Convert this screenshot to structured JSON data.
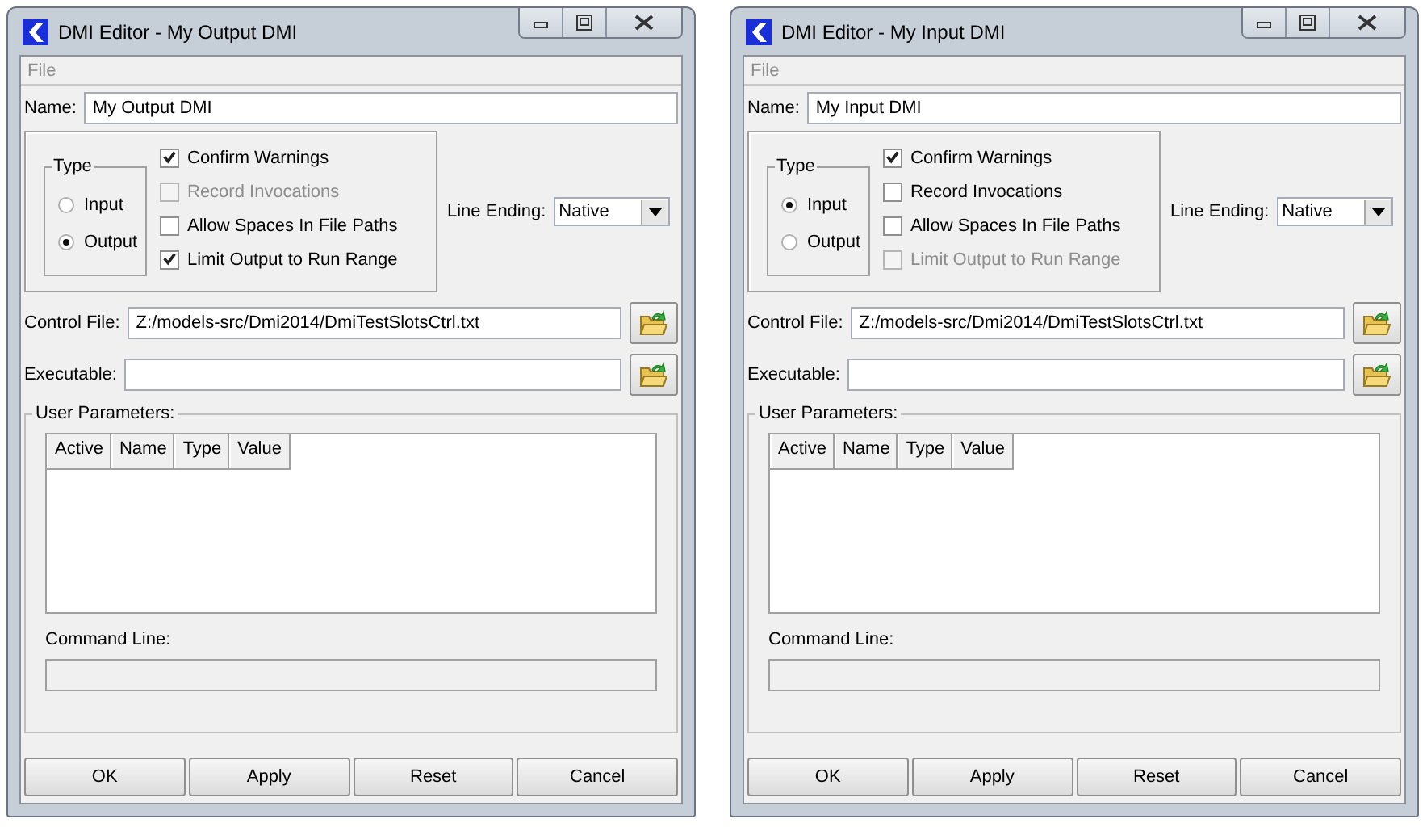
{
  "windows": [
    {
      "title": "DMI Editor - My Output DMI",
      "menu": [
        {
          "label": "File",
          "disabled": true
        }
      ],
      "name_label": "Name:",
      "name_value": "My Output DMI",
      "type_group": {
        "legend": "Type",
        "options": [
          {
            "label": "Input",
            "selected": false
          },
          {
            "label": "Output",
            "selected": true
          }
        ]
      },
      "checkboxes": [
        {
          "label": "Confirm Warnings",
          "checked": true,
          "disabled": false
        },
        {
          "label": "Record Invocations",
          "checked": false,
          "disabled": true
        },
        {
          "label": "Allow Spaces In File Paths",
          "checked": false,
          "disabled": false
        },
        {
          "label": "Limit Output to Run Range",
          "checked": true,
          "disabled": false
        }
      ],
      "line_ending": {
        "label": "Line Ending:",
        "value": "Native"
      },
      "control_file": {
        "label": "Control File:",
        "value": "Z:/models-src/Dmi2014/DmiTestSlotsCtrl.txt"
      },
      "executable": {
        "label": "Executable:"
      },
      "user_parameters": {
        "legend": "User Parameters:",
        "columns": [
          "Active",
          "Name",
          "Type",
          "Value"
        ],
        "command_line_label": "Command Line:"
      },
      "buttons": [
        "OK",
        "Apply",
        "Reset",
        "Cancel"
      ]
    },
    {
      "title": "DMI Editor - My Input DMI",
      "menu": [
        {
          "label": "File",
          "disabled": true
        }
      ],
      "name_label": "Name:",
      "name_value": "My Input DMI",
      "type_group": {
        "legend": "Type",
        "options": [
          {
            "label": "Input",
            "selected": true
          },
          {
            "label": "Output",
            "selected": false
          }
        ]
      },
      "checkboxes": [
        {
          "label": "Confirm Warnings",
          "checked": true,
          "disabled": false
        },
        {
          "label": "Record Invocations",
          "checked": false,
          "disabled": false
        },
        {
          "label": "Allow Spaces In File Paths",
          "checked": false,
          "disabled": false
        },
        {
          "label": "Limit Output to Run Range",
          "checked": false,
          "disabled": true
        }
      ],
      "line_ending": {
        "label": "Line Ending:",
        "value": "Native"
      },
      "control_file": {
        "label": "Control File:",
        "value": "Z:/models-src/Dmi2014/DmiTestSlotsCtrl.txt"
      },
      "executable": {
        "label": "Executable:"
      },
      "user_parameters": {
        "legend": "User Parameters:",
        "columns": [
          "Active",
          "Name",
          "Type",
          "Value"
        ],
        "command_line_label": "Command Line:"
      },
      "buttons": [
        "OK",
        "Apply",
        "Reset",
        "Cancel"
      ]
    }
  ]
}
